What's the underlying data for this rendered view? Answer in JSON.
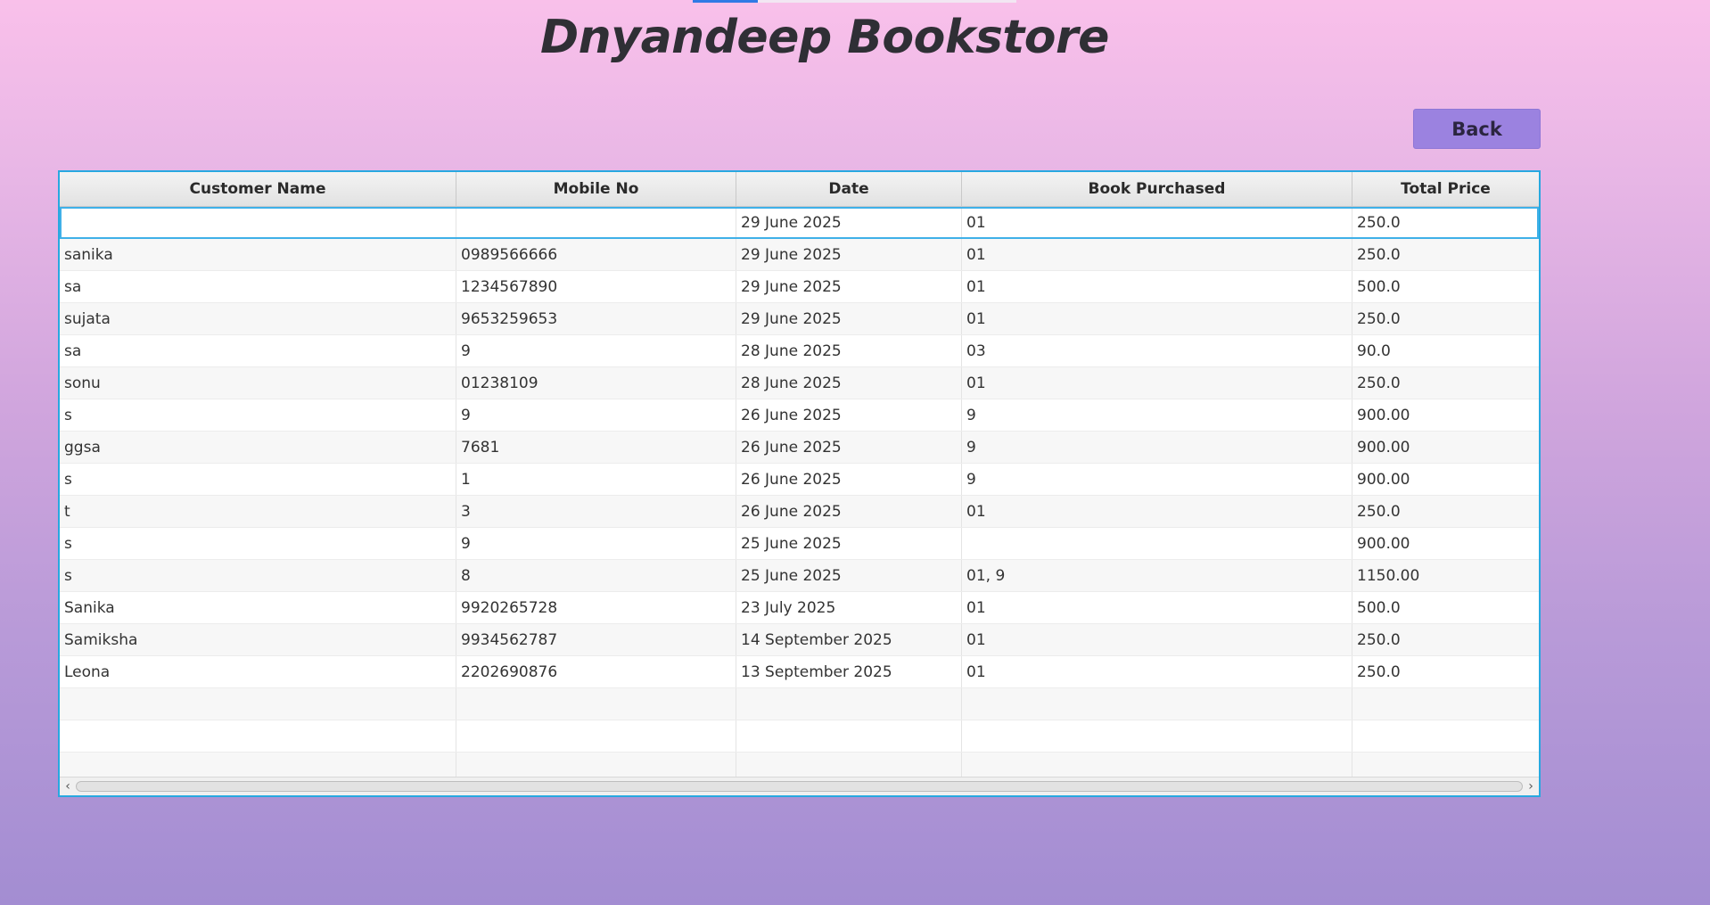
{
  "window": {
    "title": "Dnyandeep Bookstore"
  },
  "toolbar": {
    "back_label": "Back"
  },
  "table": {
    "columns": [
      "Customer Name",
      "Mobile No",
      "Date",
      "Book Purchased",
      "Total Price"
    ],
    "rows": [
      [
        "",
        "",
        "29 June 2025",
        "01",
        "250.0"
      ],
      [
        "sanika",
        "0989566666",
        "29 June 2025",
        "01",
        "250.0"
      ],
      [
        "sa",
        "1234567890",
        "29 June 2025",
        "01",
        "500.0"
      ],
      [
        "sujata",
        "9653259653",
        "29 June 2025",
        "01",
        "250.0"
      ],
      [
        "sa",
        "9",
        "28 June 2025",
        "03",
        "90.0"
      ],
      [
        "sonu",
        "01238109",
        "28 June 2025",
        "01",
        "250.0"
      ],
      [
        "s",
        "9",
        "26 June 2025",
        "9",
        "900.00"
      ],
      [
        "ggsa",
        "7681",
        "26 June 2025",
        "9",
        "900.00"
      ],
      [
        "s",
        "1",
        "26 June 2025",
        "9",
        "900.00"
      ],
      [
        "t",
        "3",
        "26 June 2025",
        "01",
        "250.0"
      ],
      [
        "s",
        "9",
        "25 June 2025",
        "",
        "900.00"
      ],
      [
        "s",
        "8",
        "25 June 2025",
        "01, 9",
        "1150.00"
      ],
      [
        "Sanika",
        "9920265728",
        "23 July 2025",
        "01",
        "500.0"
      ],
      [
        "Samiksha",
        "9934562787",
        "14 September 2025",
        "01",
        "250.0"
      ],
      [
        "Leona",
        "2202690876",
        "13 September 2025",
        "01",
        "250.0"
      ]
    ],
    "selected_row": 0,
    "empty_rows": 3
  },
  "scrollbar": {
    "left_icon": "chevron-left-icon",
    "right_icon": "chevron-right-icon"
  },
  "colors": {
    "accent": "#9b82e0",
    "selection": "#3fb0e8",
    "table_border": "#28a8e0"
  }
}
